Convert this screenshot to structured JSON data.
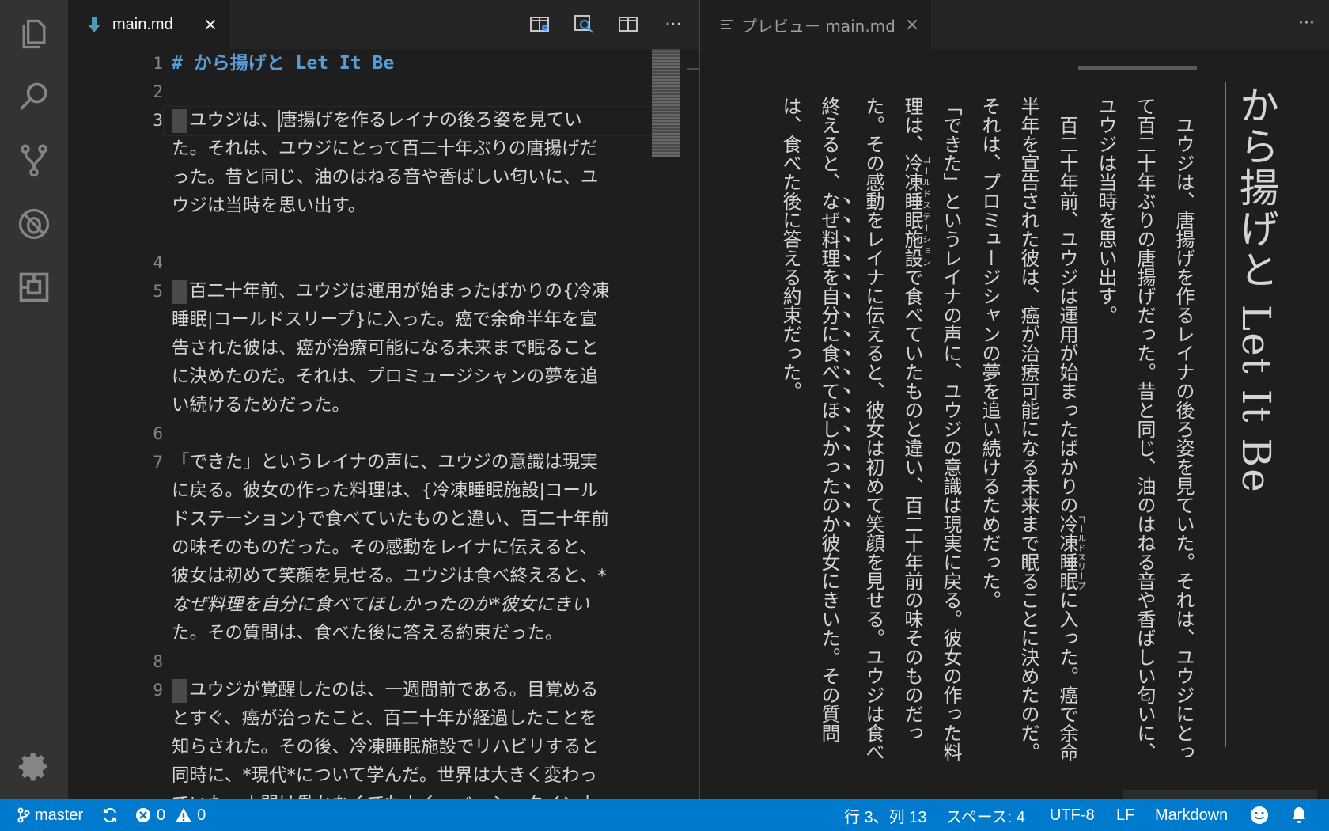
{
  "activity_bar": {
    "items": [
      "files-icon",
      "search-icon",
      "source-control-icon",
      "debug-icon",
      "extensions-icon"
    ],
    "settings": "gear-icon"
  },
  "editor_tab": {
    "filename": "main.md",
    "close": "×",
    "actions": [
      "open-preview-side-icon",
      "find-in-preview-icon",
      "split-editor-icon",
      "more-actions-icon"
    ]
  },
  "editor": {
    "line_numbers": [
      "1",
      "2",
      "3",
      "",
      "",
      "",
      "4",
      "5",
      "",
      "",
      "",
      "",
      "6",
      "7",
      "",
      "",
      "",
      "",
      "",
      "",
      "8",
      "9"
    ],
    "lines": {
      "l1": "# から揚げと Let It Be",
      "l3a": "ユウジは、",
      "l3b": "唐揚げを作るレイナの後ろ姿を見てい",
      "l3c": "た。それは、ユウジにとって百二十年ぶりの唐揚げだ",
      "l3d": "った。昔と同じ、油のはねる音や香ばしい匂いに、ユ",
      "l3e": "ウジは当時を思い出す。",
      "l5a": "百二十年前、ユウジは運用が始まったばかりの{冷凍",
      "l5b": "睡眠|コールドスリープ}に入った。癌で余命半年を宣",
      "l5c": "告された彼は、癌が治療可能になる未来まで眠ること",
      "l5d": "に決めたのだ。それは、プロミュージシャンの夢を追",
      "l5e": "い続けるためだった。",
      "l7a": "「できた」というレイナの声に、ユウジの意識は現実",
      "l7b": "に戻る。彼女の作った料理は、{冷凍睡眠施設|コール",
      "l7c": "ドステーション}で食べていたものと違い、百二十年前",
      "l7d": "の味そのものだった。その感動をレイナに伝えると、",
      "l7e": "彼女は初めて笑顔を見せる。ユウジは食べ終えると、*",
      "l7f": "なぜ料理を自分に食べてほしかったのか*彼女にきい",
      "l7g": "た。その質問は、食べた後に答える約束だった。",
      "l9a": "ユウジが覚醒したのは、一週間前である。目覚める",
      "l9b": "とすぐ、癌が治ったこと、百二十年が経過したことを",
      "l9c": "知らされた。その後、冷凍睡眠施設でリハビリすると",
      "l9d": "同時に、*現代*について学んだ。世界は大きく変わっ",
      "l9e": "ていた。人間は働かなくてもよく、ベーシックインカ"
    }
  },
  "preview_tab": {
    "title": "プレビュー main.md",
    "close": "×",
    "more": "···"
  },
  "preview": {
    "title": "から揚げと Let It Be",
    "p1": "ユウジは、唐揚げを作るレイナの後ろ姿を見ていた。それは、ユウジにとって百二十年ぶりの唐揚げだった。昔と同じ、油のはねる音や香ばしい匂いに、ユウジは当時を思い出す。",
    "p2a": "百二十年前、ユウジは運用が始まったばかりの",
    "p2_ruby_base": "冷凍睡眠",
    "p2_ruby_text": "コールドスリープ",
    "p2b": "に入った。癌で余命半年を宣告された彼は、癌が治療可能になる未来まで眠ることに決めたのだ。それは、プロミュージシャンの夢を追い続けるためだった。",
    "p3a": "「できた」というレイナの声に、ユウジの意識は現実に戻る。彼女の作った料理は、",
    "p3_ruby_base": "冷凍睡眠施設",
    "p3_ruby_text": "コールドステーション",
    "p3b": "で食べていたものと違い、百二十年前の味そのものだった。その感動をレイナに伝えると、彼女は初めて笑顔を見せる。ユウジは食べ終えると、",
    "p3_em": "なぜ料理を自分に食べてほしかったのか",
    "p3c": "彼女にきいた。その質問は、食べた後に答える約束だった。"
  },
  "status_bar": {
    "branch": "master",
    "errors": "0",
    "warnings": "0",
    "position": "行 3、列 13",
    "indent": "スペース: 4",
    "encoding": "UTF-8",
    "eol": "LF",
    "language": "Markdown"
  }
}
